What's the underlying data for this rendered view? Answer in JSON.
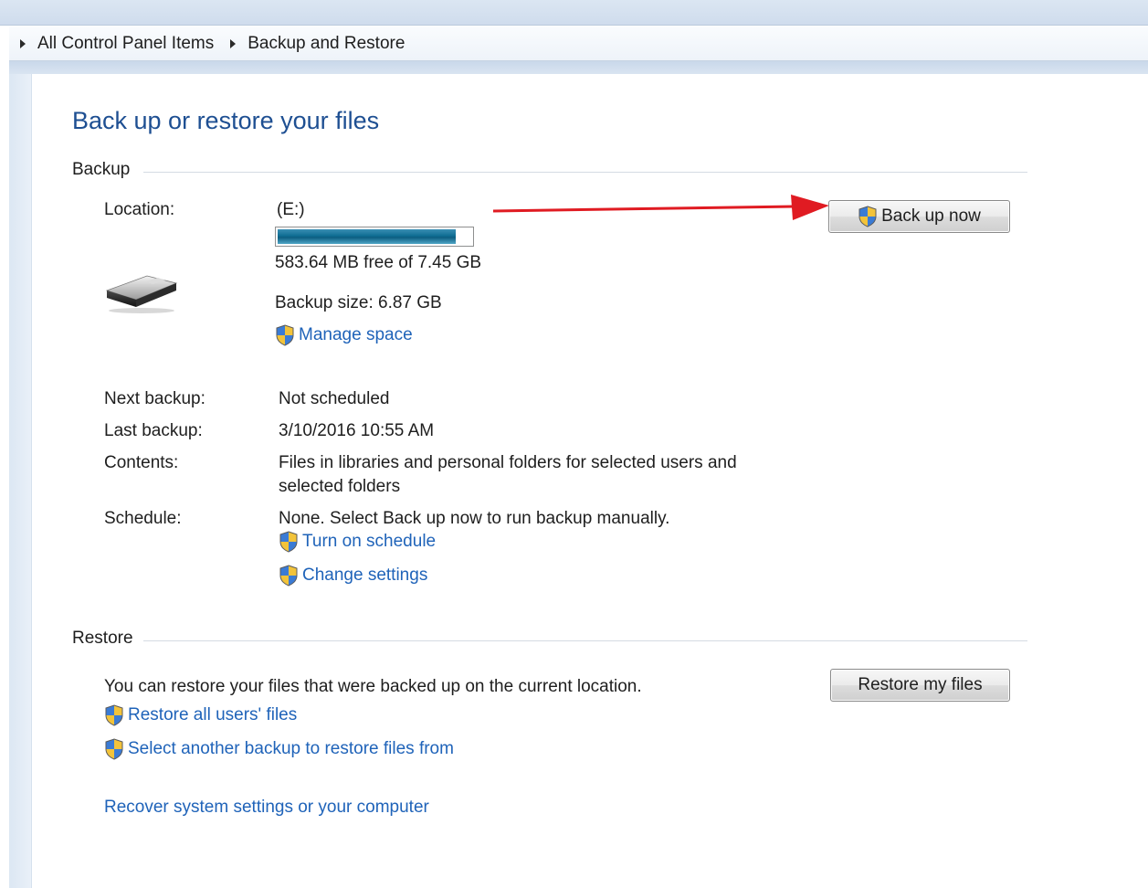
{
  "breadcrumb": {
    "items": [
      "All Control Panel Items",
      "Backup and Restore"
    ]
  },
  "page": {
    "title": "Back up or restore your files"
  },
  "backup": {
    "section_label": "Backup",
    "location_label": "Location:",
    "location_value": "(E:)",
    "disk_used_fraction": 0.92,
    "free_space_text": "583.64 MB free of 7.45 GB",
    "backup_size_text": "Backup size: 6.87 GB",
    "manage_space_link": "Manage space",
    "back_up_now_button": "Back up now",
    "next_backup_label": "Next backup:",
    "next_backup_value": "Not scheduled",
    "last_backup_label": "Last backup:",
    "last_backup_value": "3/10/2016 10:55 AM",
    "contents_label": "Contents:",
    "contents_value_line1": "Files in libraries and personal folders for selected users and",
    "contents_value_line2": "selected folders",
    "schedule_label": "Schedule:",
    "schedule_value": "None. Select Back up now to run backup manually.",
    "turn_on_schedule_link": "Turn on schedule",
    "change_settings_link": "Change settings"
  },
  "restore": {
    "section_label": "Restore",
    "description": "You can restore your files that were backed up on the current location.",
    "restore_my_files_button": "Restore my files",
    "restore_all_users_link": "Restore all users' files",
    "select_another_backup_link": "Select another backup to restore files from",
    "recover_system_link": "Recover system settings or your computer"
  },
  "colors": {
    "link": "#1f63b9",
    "title": "#1e4f92",
    "progress_fill": "#0f6d93",
    "annotation_arrow": "#e01b22"
  },
  "icons": {
    "breadcrumb_separator": "triangle-right-icon",
    "drive": "removable-drive-icon",
    "uac": "uac-shield-icon",
    "annotation": "red-arrow-icon"
  }
}
